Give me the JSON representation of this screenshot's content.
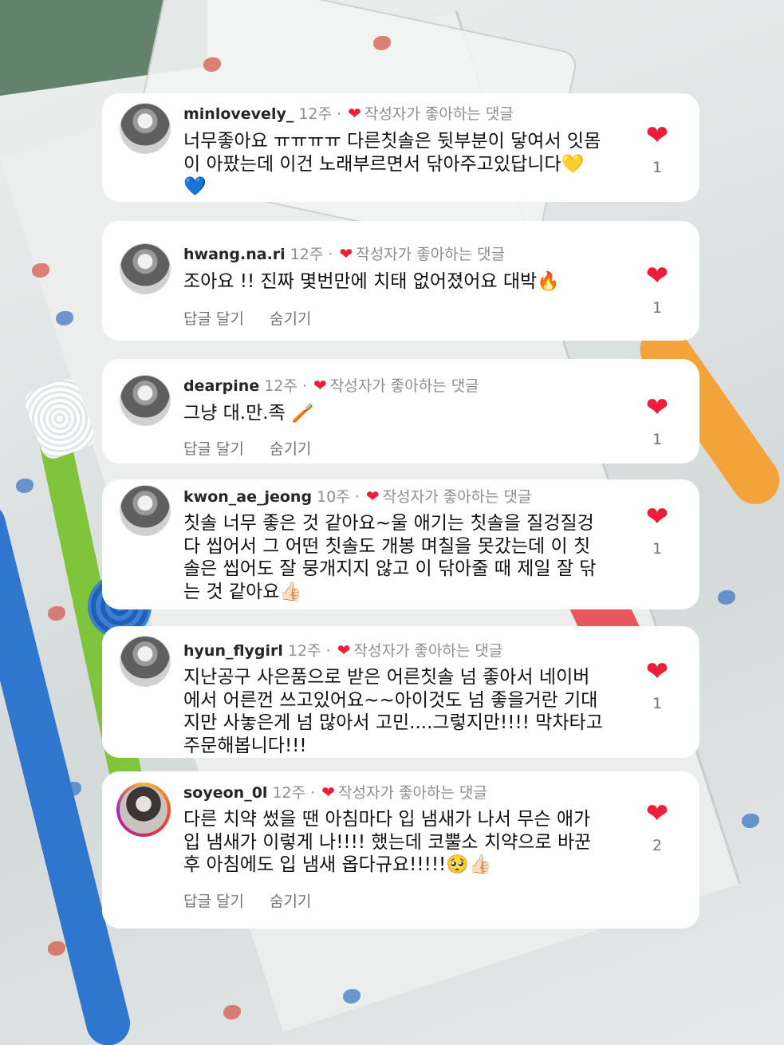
{
  "comments": [
    {
      "username": "minlovevely_",
      "time": "12주",
      "liked_label": "작성자가 좋아하는 댓글",
      "text": "너무좋아요 ㅠㅠㅠㅠ 다른칫솔은 뒷부분이 닿여서 잇몸이 아팠는데 이건 노래부르면서 닦아주고있답니다💛💙",
      "likes": "1"
    },
    {
      "username": "hwang.na.ri",
      "time": "12주",
      "liked_label": "작성자가 좋아하는 댓글",
      "text": "조아요 !! 진짜 몇번만에 치태 없어졌어요 대박🔥",
      "reply": "답글 달기",
      "hide": "숨기기",
      "likes": "1"
    },
    {
      "username": "dearpine",
      "time": "12주",
      "liked_label": "작성자가 좋아하는 댓글",
      "text": "그냥 대.만.족 🪥",
      "reply": "답글 달기",
      "hide": "숨기기",
      "likes": "1"
    },
    {
      "username": "kwon_ae_jeong",
      "time": "10주",
      "liked_label": "작성자가 좋아하는 댓글",
      "text": "칫솔 너무 좋은 것 같아요~울 애기는 칫솔을 질겅질겅 다 씹어서 그 어떤 칫솔도 개봉 며칠을 못갔는데 이 칫솔은 씹어도 잘 뭉개지지 않고 이 닦아줄 때 제일 잘 닦는 것 같아요👍🏻",
      "likes": "1"
    },
    {
      "username": "hyun_flygirl",
      "time": "12주",
      "liked_label": "작성자가 좋아하는 댓글",
      "text": "지난공구 사은품으로 받은 어른칫솔 넘 좋아서 네이버에서 어른껀 쓰고있어요~~아이것도 넘 좋을거란 기대지만 사놓은게 넘 많아서 고민....그렇지만!!!! 막차타고 주문해봅니다!!!",
      "likes": "1"
    },
    {
      "username": "soyeon_0l",
      "time": "12주",
      "liked_label": "작성자가 좋아하는 댓글",
      "text": "다른 치약 썼을 땐 아침마다 입 냄새가 나서 무슨 애가 입 냄새가 이렇게 나!!!! 했는데 코뿔소 치약으로 바꾼 후 아침에도 입 냄새 옵다규요!!!!!🥺👍🏻",
      "reply": "답글 달기",
      "hide": "숨기기",
      "likes": "2"
    }
  ],
  "colors": {
    "heart": "#ed1e3a",
    "meta": "#8e8e8e",
    "card": "#ffffff"
  },
  "icons": {
    "like": "heart-icon",
    "author_liked": "heart-small-icon"
  }
}
